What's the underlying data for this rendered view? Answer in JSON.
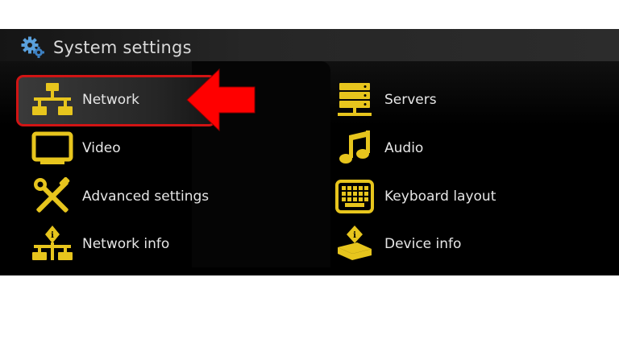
{
  "colors": {
    "accent_yellow": "#e7c51d",
    "highlight_border": "#d11414",
    "arrow_red": "#ff0000",
    "text": "#e6e6e6"
  },
  "header": {
    "title": "System settings",
    "icon": "gears-icon"
  },
  "menu": {
    "left": [
      {
        "label": "Network",
        "icon": "network-icon",
        "selected": true
      },
      {
        "label": "Video",
        "icon": "monitor-icon"
      },
      {
        "label": "Advanced settings",
        "icon": "tools-icon"
      },
      {
        "label": "Network info",
        "icon": "network-info-icon"
      }
    ],
    "right": [
      {
        "label": "Servers",
        "icon": "servers-icon"
      },
      {
        "label": "Audio",
        "icon": "music-note-icon"
      },
      {
        "label": "Keyboard layout",
        "icon": "keyboard-icon"
      },
      {
        "label": "Device info",
        "icon": "device-info-icon"
      }
    ]
  },
  "annotation": {
    "icon": "red-arrow-icon"
  }
}
